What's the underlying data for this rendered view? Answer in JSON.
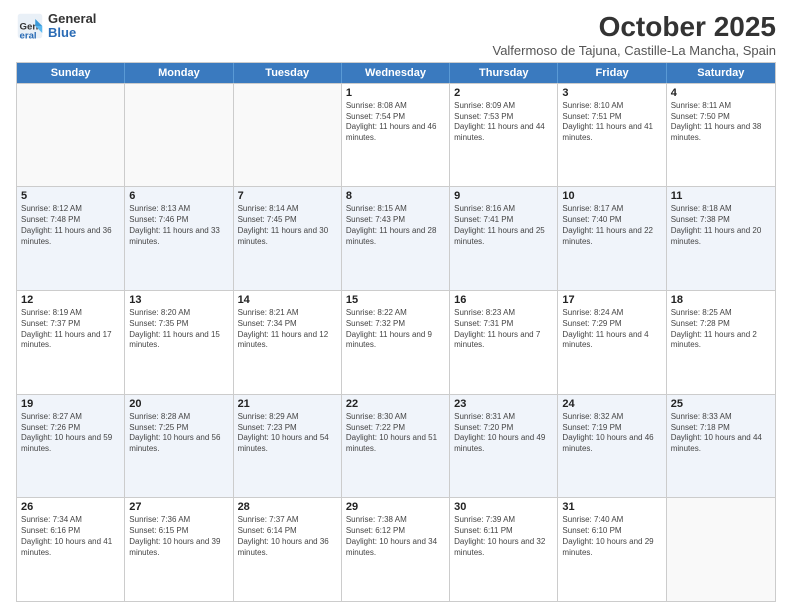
{
  "logo": {
    "general": "General",
    "blue": "Blue"
  },
  "title": "October 2025",
  "subtitle": "Valfermoso de Tajuna, Castille-La Mancha, Spain",
  "days": [
    "Sunday",
    "Monday",
    "Tuesday",
    "Wednesday",
    "Thursday",
    "Friday",
    "Saturday"
  ],
  "weeks": [
    [
      {
        "day": "",
        "text": ""
      },
      {
        "day": "",
        "text": ""
      },
      {
        "day": "",
        "text": ""
      },
      {
        "day": "1",
        "text": "Sunrise: 8:08 AM\nSunset: 7:54 PM\nDaylight: 11 hours and 46 minutes."
      },
      {
        "day": "2",
        "text": "Sunrise: 8:09 AM\nSunset: 7:53 PM\nDaylight: 11 hours and 44 minutes."
      },
      {
        "day": "3",
        "text": "Sunrise: 8:10 AM\nSunset: 7:51 PM\nDaylight: 11 hours and 41 minutes."
      },
      {
        "day": "4",
        "text": "Sunrise: 8:11 AM\nSunset: 7:50 PM\nDaylight: 11 hours and 38 minutes."
      }
    ],
    [
      {
        "day": "5",
        "text": "Sunrise: 8:12 AM\nSunset: 7:48 PM\nDaylight: 11 hours and 36 minutes."
      },
      {
        "day": "6",
        "text": "Sunrise: 8:13 AM\nSunset: 7:46 PM\nDaylight: 11 hours and 33 minutes."
      },
      {
        "day": "7",
        "text": "Sunrise: 8:14 AM\nSunset: 7:45 PM\nDaylight: 11 hours and 30 minutes."
      },
      {
        "day": "8",
        "text": "Sunrise: 8:15 AM\nSunset: 7:43 PM\nDaylight: 11 hours and 28 minutes."
      },
      {
        "day": "9",
        "text": "Sunrise: 8:16 AM\nSunset: 7:41 PM\nDaylight: 11 hours and 25 minutes."
      },
      {
        "day": "10",
        "text": "Sunrise: 8:17 AM\nSunset: 7:40 PM\nDaylight: 11 hours and 22 minutes."
      },
      {
        "day": "11",
        "text": "Sunrise: 8:18 AM\nSunset: 7:38 PM\nDaylight: 11 hours and 20 minutes."
      }
    ],
    [
      {
        "day": "12",
        "text": "Sunrise: 8:19 AM\nSunset: 7:37 PM\nDaylight: 11 hours and 17 minutes."
      },
      {
        "day": "13",
        "text": "Sunrise: 8:20 AM\nSunset: 7:35 PM\nDaylight: 11 hours and 15 minutes."
      },
      {
        "day": "14",
        "text": "Sunrise: 8:21 AM\nSunset: 7:34 PM\nDaylight: 11 hours and 12 minutes."
      },
      {
        "day": "15",
        "text": "Sunrise: 8:22 AM\nSunset: 7:32 PM\nDaylight: 11 hours and 9 minutes."
      },
      {
        "day": "16",
        "text": "Sunrise: 8:23 AM\nSunset: 7:31 PM\nDaylight: 11 hours and 7 minutes."
      },
      {
        "day": "17",
        "text": "Sunrise: 8:24 AM\nSunset: 7:29 PM\nDaylight: 11 hours and 4 minutes."
      },
      {
        "day": "18",
        "text": "Sunrise: 8:25 AM\nSunset: 7:28 PM\nDaylight: 11 hours and 2 minutes."
      }
    ],
    [
      {
        "day": "19",
        "text": "Sunrise: 8:27 AM\nSunset: 7:26 PM\nDaylight: 10 hours and 59 minutes."
      },
      {
        "day": "20",
        "text": "Sunrise: 8:28 AM\nSunset: 7:25 PM\nDaylight: 10 hours and 56 minutes."
      },
      {
        "day": "21",
        "text": "Sunrise: 8:29 AM\nSunset: 7:23 PM\nDaylight: 10 hours and 54 minutes."
      },
      {
        "day": "22",
        "text": "Sunrise: 8:30 AM\nSunset: 7:22 PM\nDaylight: 10 hours and 51 minutes."
      },
      {
        "day": "23",
        "text": "Sunrise: 8:31 AM\nSunset: 7:20 PM\nDaylight: 10 hours and 49 minutes."
      },
      {
        "day": "24",
        "text": "Sunrise: 8:32 AM\nSunset: 7:19 PM\nDaylight: 10 hours and 46 minutes."
      },
      {
        "day": "25",
        "text": "Sunrise: 8:33 AM\nSunset: 7:18 PM\nDaylight: 10 hours and 44 minutes."
      }
    ],
    [
      {
        "day": "26",
        "text": "Sunrise: 7:34 AM\nSunset: 6:16 PM\nDaylight: 10 hours and 41 minutes."
      },
      {
        "day": "27",
        "text": "Sunrise: 7:36 AM\nSunset: 6:15 PM\nDaylight: 10 hours and 39 minutes."
      },
      {
        "day": "28",
        "text": "Sunrise: 7:37 AM\nSunset: 6:14 PM\nDaylight: 10 hours and 36 minutes."
      },
      {
        "day": "29",
        "text": "Sunrise: 7:38 AM\nSunset: 6:12 PM\nDaylight: 10 hours and 34 minutes."
      },
      {
        "day": "30",
        "text": "Sunrise: 7:39 AM\nSunset: 6:11 PM\nDaylight: 10 hours and 32 minutes."
      },
      {
        "day": "31",
        "text": "Sunrise: 7:40 AM\nSunset: 6:10 PM\nDaylight: 10 hours and 29 minutes."
      },
      {
        "day": "",
        "text": ""
      }
    ]
  ]
}
